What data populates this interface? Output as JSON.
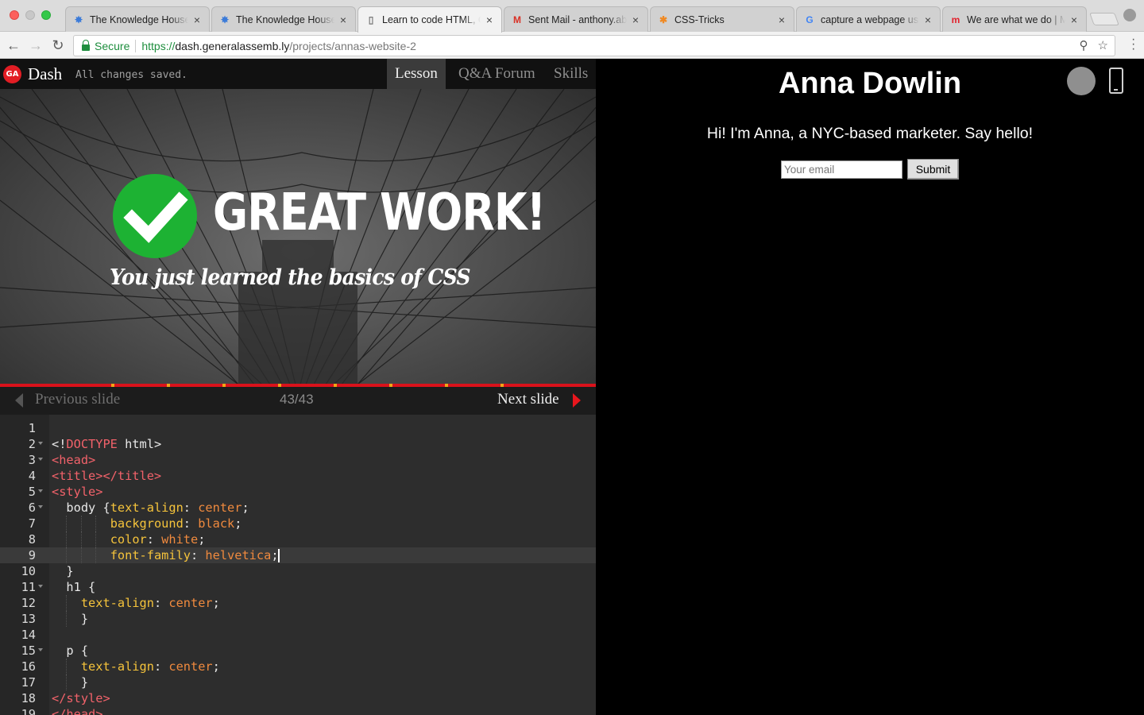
{
  "browser": {
    "tabs": [
      {
        "title": "The Knowledge House",
        "favicon": "pinwheel-icon",
        "active": false
      },
      {
        "title": "The Knowledge House",
        "favicon": "pinwheel-icon",
        "active": false
      },
      {
        "title": "Learn to code HTML, CSS",
        "favicon": "document-icon",
        "active": true
      },
      {
        "title": "Sent Mail - anthony.abe",
        "favicon": "gmail-icon",
        "active": false
      },
      {
        "title": "CSS-Tricks",
        "favicon": "star-icon",
        "active": false
      },
      {
        "title": "capture a webpage using",
        "favicon": "google-icon",
        "active": false
      },
      {
        "title": "We are what we do | Mo",
        "favicon": "m-icon",
        "active": false
      }
    ],
    "address": {
      "secure_label": "Secure",
      "scheme": "https://",
      "host": "dash.generalassemb.ly",
      "path": "/projects/annas-website-2"
    }
  },
  "dash": {
    "logo_text": "GA",
    "title": "Dash",
    "status": "All changes saved.",
    "tabs": [
      {
        "label": "Lesson",
        "active": true
      },
      {
        "label": "Q&A Forum",
        "active": false
      },
      {
        "label": "Skills",
        "active": false
      }
    ]
  },
  "slide": {
    "headline": "GREAT WORK!",
    "subtitle": "You just learned the basics of CSS",
    "progress_fraction": 1.0
  },
  "slide_nav": {
    "prev_label": "Previous slide",
    "counter": "43/43",
    "next_label": "Next slide"
  },
  "editor": {
    "current_line": 9,
    "lines": [
      {
        "n": "1",
        "fold": false,
        "indent": 0,
        "tokens": []
      },
      {
        "n": "2",
        "fold": true,
        "indent": 0,
        "tokens": [
          [
            "plain",
            "<!"
          ],
          [
            "tag",
            "DOCTYPE"
          ],
          [
            "plain",
            " html>"
          ]
        ]
      },
      {
        "n": "3",
        "fold": true,
        "indent": 0,
        "tokens": [
          [
            "tag",
            "<head>"
          ]
        ]
      },
      {
        "n": "4",
        "fold": false,
        "indent": 0,
        "tokens": [
          [
            "tag",
            "<title></title>"
          ]
        ]
      },
      {
        "n": "5",
        "fold": true,
        "indent": 0,
        "tokens": [
          [
            "tag",
            "<style>"
          ]
        ]
      },
      {
        "n": "6",
        "fold": true,
        "indent": 1,
        "tokens": [
          [
            "plain",
            "  body {"
          ],
          [
            "prop",
            "text-align"
          ],
          [
            "plain",
            ": "
          ],
          [
            "val",
            "center"
          ],
          [
            "plain",
            ";"
          ]
        ]
      },
      {
        "n": "7",
        "fold": false,
        "indent": 4,
        "tokens": [
          [
            "plain",
            "        "
          ],
          [
            "prop",
            "background"
          ],
          [
            "plain",
            ": "
          ],
          [
            "val",
            "black"
          ],
          [
            "plain",
            ";"
          ]
        ]
      },
      {
        "n": "8",
        "fold": false,
        "indent": 4,
        "tokens": [
          [
            "plain",
            "        "
          ],
          [
            "prop",
            "color"
          ],
          [
            "plain",
            ": "
          ],
          [
            "val",
            "white"
          ],
          [
            "plain",
            ";"
          ]
        ]
      },
      {
        "n": "9",
        "fold": false,
        "indent": 4,
        "tokens": [
          [
            "plain",
            "        "
          ],
          [
            "prop",
            "font-family"
          ],
          [
            "plain",
            ": "
          ],
          [
            "val",
            "helvetica"
          ],
          [
            "plain",
            ";"
          ]
        ]
      },
      {
        "n": "10",
        "fold": false,
        "indent": 1,
        "tokens": [
          [
            "plain",
            "  }"
          ]
        ]
      },
      {
        "n": "11",
        "fold": true,
        "indent": 1,
        "tokens": [
          [
            "plain",
            "  h1 {"
          ]
        ]
      },
      {
        "n": "12",
        "fold": false,
        "indent": 2,
        "tokens": [
          [
            "plain",
            "    "
          ],
          [
            "prop",
            "text-align"
          ],
          [
            "plain",
            ": "
          ],
          [
            "val",
            "center"
          ],
          [
            "plain",
            ";"
          ]
        ]
      },
      {
        "n": "13",
        "fold": false,
        "indent": 2,
        "tokens": [
          [
            "plain",
            "    }"
          ]
        ]
      },
      {
        "n": "14",
        "fold": false,
        "indent": 0,
        "tokens": []
      },
      {
        "n": "15",
        "fold": true,
        "indent": 1,
        "tokens": [
          [
            "plain",
            "  p {"
          ]
        ]
      },
      {
        "n": "16",
        "fold": false,
        "indent": 2,
        "tokens": [
          [
            "plain",
            "    "
          ],
          [
            "prop",
            "text-align"
          ],
          [
            "plain",
            ": "
          ],
          [
            "val",
            "center"
          ],
          [
            "plain",
            ";"
          ]
        ]
      },
      {
        "n": "17",
        "fold": false,
        "indent": 2,
        "tokens": [
          [
            "plain",
            "    }"
          ]
        ]
      },
      {
        "n": "18",
        "fold": false,
        "indent": 0,
        "tokens": [
          [
            "tag",
            "</style>"
          ]
        ]
      },
      {
        "n": "19",
        "fold": false,
        "indent": 0,
        "tokens": [
          [
            "tag",
            "</head>"
          ]
        ]
      }
    ]
  },
  "preview": {
    "heading": "Anna Dowlin",
    "text": "Hi! I'm Anna, a NYC-based marketer. Say hello!",
    "email_placeholder": "Your email",
    "submit_label": "Submit"
  },
  "colors": {
    "accent_red": "#e21d24",
    "check_green": "#1db233",
    "tag": "#f2626a",
    "property": "#f5c33b",
    "value": "#f08a3e"
  }
}
